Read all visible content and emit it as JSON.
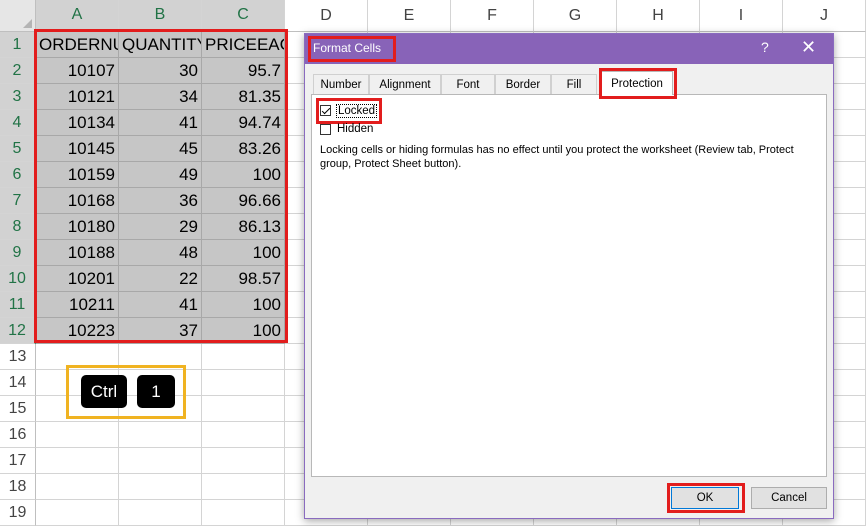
{
  "sheet": {
    "columns": [
      "A",
      "B",
      "C",
      "D",
      "E",
      "F",
      "G",
      "H",
      "I",
      "J"
    ],
    "rows": [
      "1",
      "2",
      "3",
      "4",
      "5",
      "6",
      "7",
      "8",
      "9",
      "10",
      "11",
      "12",
      "13",
      "14",
      "15",
      "16",
      "17",
      "18",
      "19"
    ],
    "headers": [
      "ORDERNU",
      "QUANTITY",
      "PRICEEACH"
    ],
    "data": [
      [
        "10107",
        "30",
        "95.7"
      ],
      [
        "10121",
        "34",
        "81.35"
      ],
      [
        "10134",
        "41",
        "94.74"
      ],
      [
        "10145",
        "45",
        "83.26"
      ],
      [
        "10159",
        "49",
        "100"
      ],
      [
        "10168",
        "36",
        "96.66"
      ],
      [
        "10180",
        "29",
        "86.13"
      ],
      [
        "10188",
        "48",
        "100"
      ],
      [
        "10201",
        "22",
        "98.57"
      ],
      [
        "10211",
        "41",
        "100"
      ],
      [
        "10223",
        "37",
        "100"
      ]
    ]
  },
  "shortcut": {
    "key1": "Ctrl",
    "key2": "1"
  },
  "dialog": {
    "title": "Format Cells",
    "help": "?",
    "close": "✕",
    "tabs": [
      "Number",
      "Alignment",
      "Font",
      "Border",
      "Fill",
      "Protection"
    ],
    "active_tab": "Protection",
    "locked_label": "Locked",
    "locked_checked": true,
    "hidden_label": "Hidden",
    "hidden_checked": false,
    "note": "Locking cells or hiding formulas has no effect until you protect the worksheet (Review tab, Protect group, Protect Sheet button).",
    "ok_label": "OK",
    "cancel_label": "Cancel"
  },
  "colors": {
    "title_bar": "#8863b8",
    "highlight_red": "#e21d1d",
    "highlight_yellow": "#f0b321",
    "selection": "#c6c6c6"
  }
}
